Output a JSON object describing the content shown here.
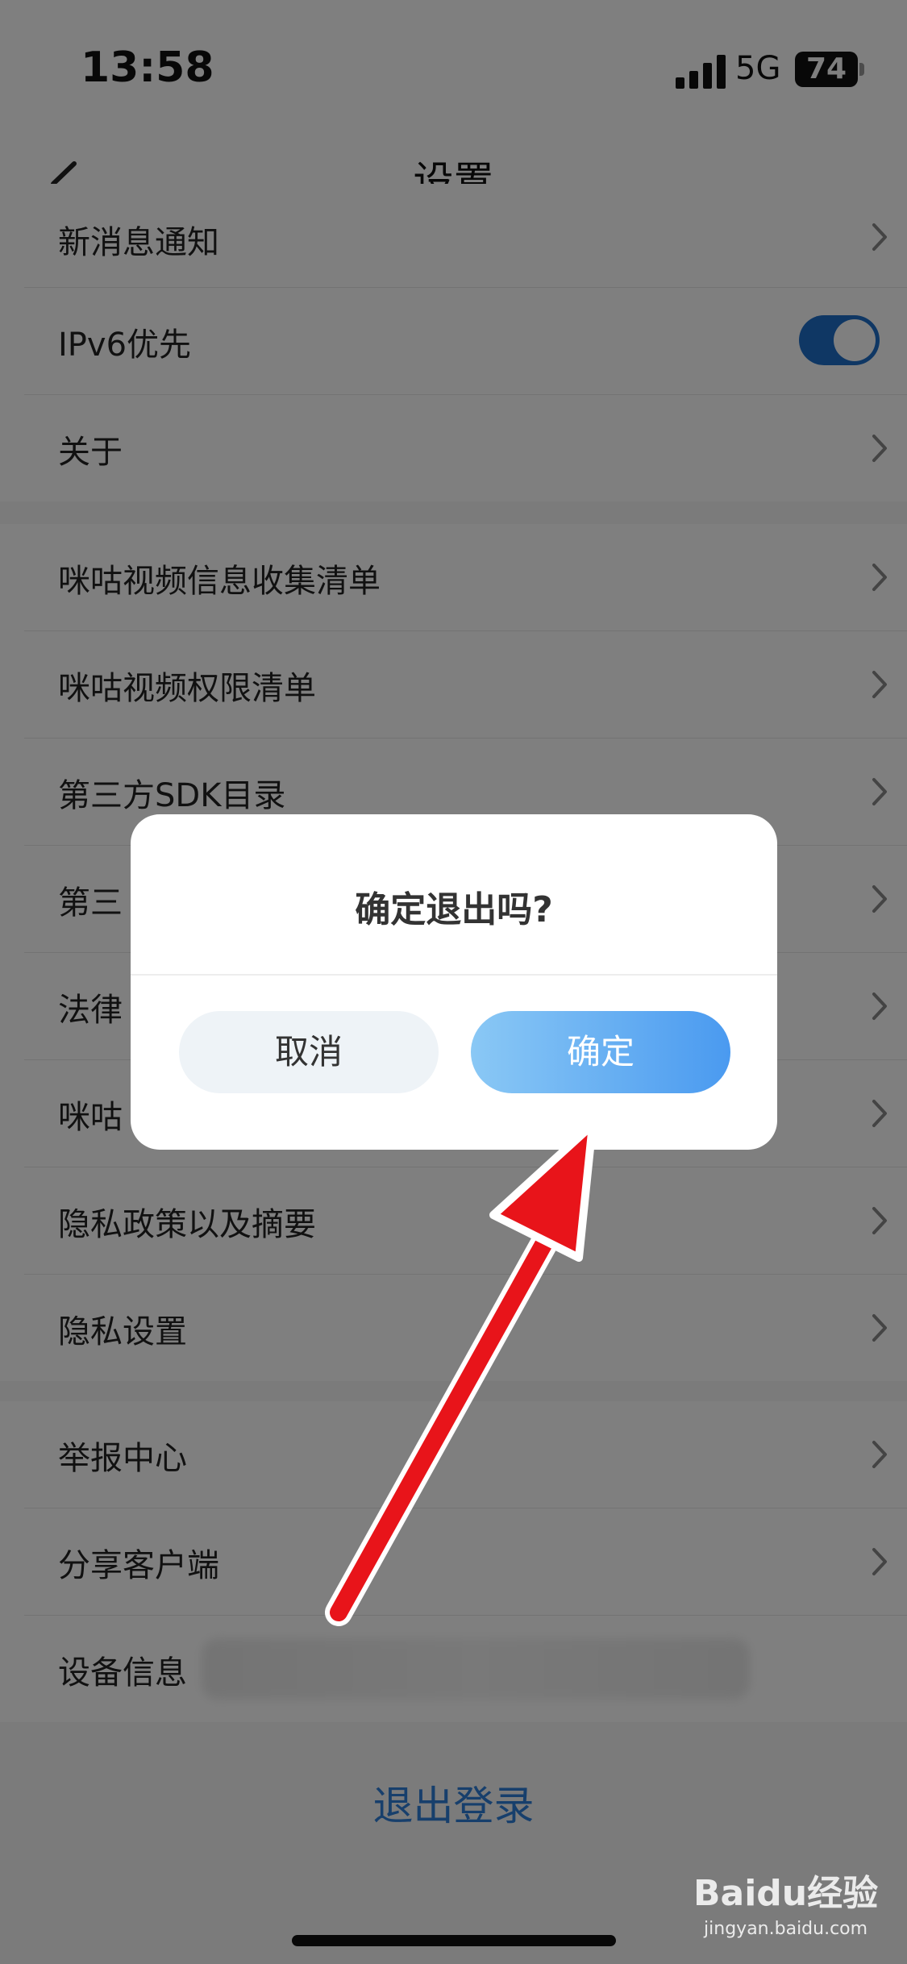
{
  "status_bar": {
    "time": "13:58",
    "network": "5G",
    "battery": "74"
  },
  "nav": {
    "title": "设置"
  },
  "groups": [
    {
      "items": [
        {
          "label": "新消息通知",
          "type": "chevron"
        },
        {
          "label": "IPv6优先",
          "type": "toggle",
          "toggle_on": true
        },
        {
          "label": "关于",
          "type": "chevron"
        }
      ]
    },
    {
      "items": [
        {
          "label": "咪咕视频信息收集清单",
          "type": "chevron"
        },
        {
          "label": "咪咕视频权限清单",
          "type": "chevron"
        },
        {
          "label": "第三方SDK目录",
          "type": "chevron"
        },
        {
          "label": "第三",
          "type": "chevron"
        },
        {
          "label": "法律",
          "type": "chevron"
        },
        {
          "label": "咪咕",
          "type": "chevron"
        },
        {
          "label": "隐私政策以及摘要",
          "type": "chevron"
        },
        {
          "label": "隐私设置",
          "type": "chevron"
        }
      ]
    },
    {
      "items": [
        {
          "label": "举报中心",
          "type": "chevron"
        },
        {
          "label": "分享客户端",
          "type": "chevron"
        },
        {
          "label": "设备信息",
          "type": "blurred"
        }
      ]
    }
  ],
  "logout_label": "退出登录",
  "dialog": {
    "title": "确定退出吗?",
    "cancel_label": "取消",
    "confirm_label": "确定"
  },
  "watermark": {
    "brand": "Baidu经验",
    "url": "jingyan.baidu.com"
  },
  "colors": {
    "toggle_on": "#1e6fc8",
    "link": "#2f7ed8",
    "confirm_start": "#8ac8f5",
    "confirm_end": "#4a9af0",
    "annotation_arrow": "#e8141a"
  }
}
